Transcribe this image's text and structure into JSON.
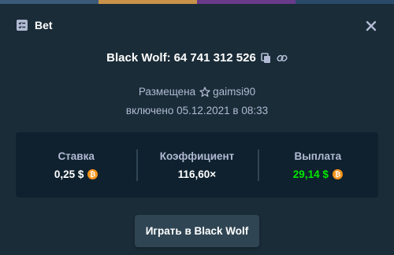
{
  "colors": {
    "background": "#1a2c38",
    "panel": "#0f212e",
    "muted_text": "#b1bad3",
    "accent_green": "#00e701",
    "button": "#2f4553",
    "coin": "#f7931a"
  },
  "header": {
    "icon": "ticket-icon",
    "title": "Bet",
    "close_icon": "close-icon"
  },
  "game": {
    "name": "Black Wolf",
    "separator": ":",
    "bet_id": "64 741 312 526",
    "copy_icon": "copy-icon",
    "link_icon": "link-icon"
  },
  "placed": {
    "label": "Размещена",
    "star_icon": "star-icon",
    "user": "gaimsi90"
  },
  "date_text": "включено 05.12.2021 в 08:33",
  "stats": {
    "bet": {
      "label": "Ставка",
      "value": "0,25 $",
      "icon": "bitcoin-icon"
    },
    "multiplier": {
      "label": "Коэффициент",
      "value": "116,60×"
    },
    "payout": {
      "label": "Выплата",
      "value": "29,14 $",
      "icon": "bitcoin-icon"
    }
  },
  "play_button": "Играть в Black Wolf"
}
